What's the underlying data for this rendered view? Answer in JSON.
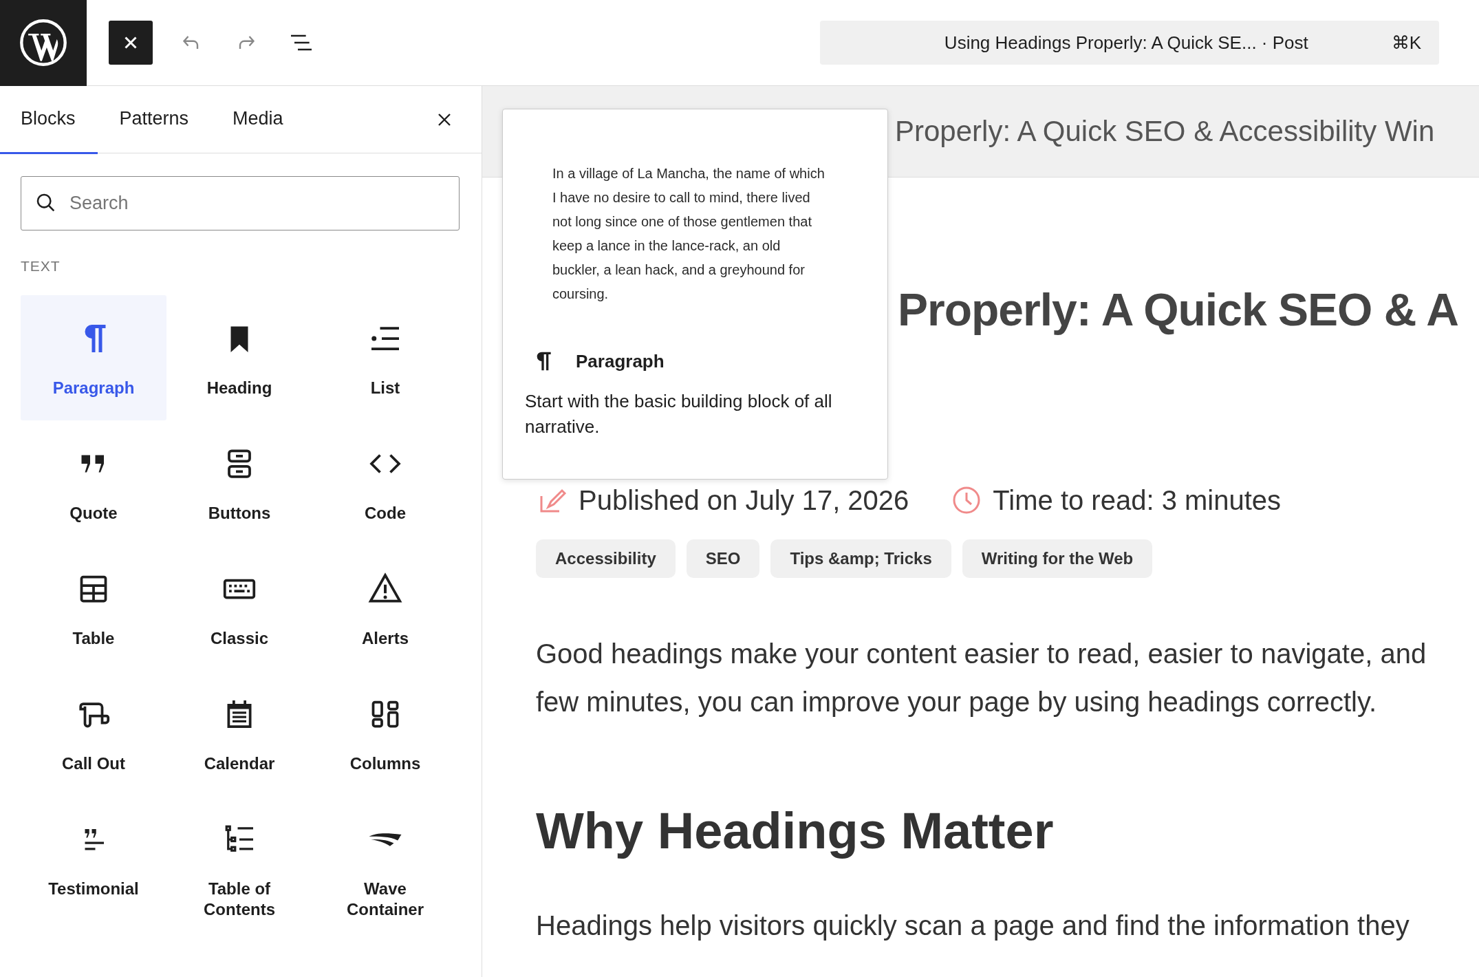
{
  "toolbar": {
    "command_bar": {
      "title": "Using Headings Properly: A Quick SE...",
      "type": "· Post",
      "shortcut": "⌘K"
    }
  },
  "inserter": {
    "tabs": [
      {
        "label": "Blocks",
        "selected": true
      },
      {
        "label": "Patterns",
        "selected": false
      },
      {
        "label": "Media",
        "selected": false
      }
    ],
    "search": {
      "placeholder": "Search"
    },
    "category": "TEXT",
    "blocks": [
      {
        "label": "Paragraph",
        "selected": true
      },
      {
        "label": "Heading",
        "selected": false
      },
      {
        "label": "List",
        "selected": false
      },
      {
        "label": "Quote",
        "selected": false
      },
      {
        "label": "Buttons",
        "selected": false
      },
      {
        "label": "Code",
        "selected": false
      },
      {
        "label": "Table",
        "selected": false
      },
      {
        "label": "Classic",
        "selected": false
      },
      {
        "label": "Alerts",
        "selected": false
      },
      {
        "label": "Call Out",
        "selected": false
      },
      {
        "label": "Calendar",
        "selected": false
      },
      {
        "label": "Columns",
        "selected": false
      },
      {
        "label": "Testimonial",
        "selected": false
      },
      {
        "label": "Table of Contents",
        "selected": false
      },
      {
        "label": "Wave Container",
        "selected": false
      }
    ]
  },
  "preview_popover": {
    "sample": "In a village of La Mancha, the name of which I have no desire to call to mind, there lived not long since one of those gentlemen that keep a lance in the lance-rack, an old buckler, a lean hack, and a greyhound for coursing.",
    "block_name": "Paragraph",
    "description": "Start with the basic building block of all narrative."
  },
  "editor": {
    "title_bar": "Properly: A Quick SEO & Accessibility Win",
    "post_title": "Properly: A Quick SEO & A",
    "published": "Published on July 17, 2026",
    "read_time": "Time to read: 3 minutes",
    "tags": [
      "Accessibility",
      "SEO",
      "Tips &amp; Tricks",
      "Writing for the Web"
    ],
    "intro_lines": [
      "Good headings make your content easier to read, easier to navigate, and",
      "few minutes, you can improve your page by using headings correctly."
    ],
    "section_heading": "Why Headings Matter",
    "section_text": "Headings help visitors quickly scan a page and find the information they"
  }
}
